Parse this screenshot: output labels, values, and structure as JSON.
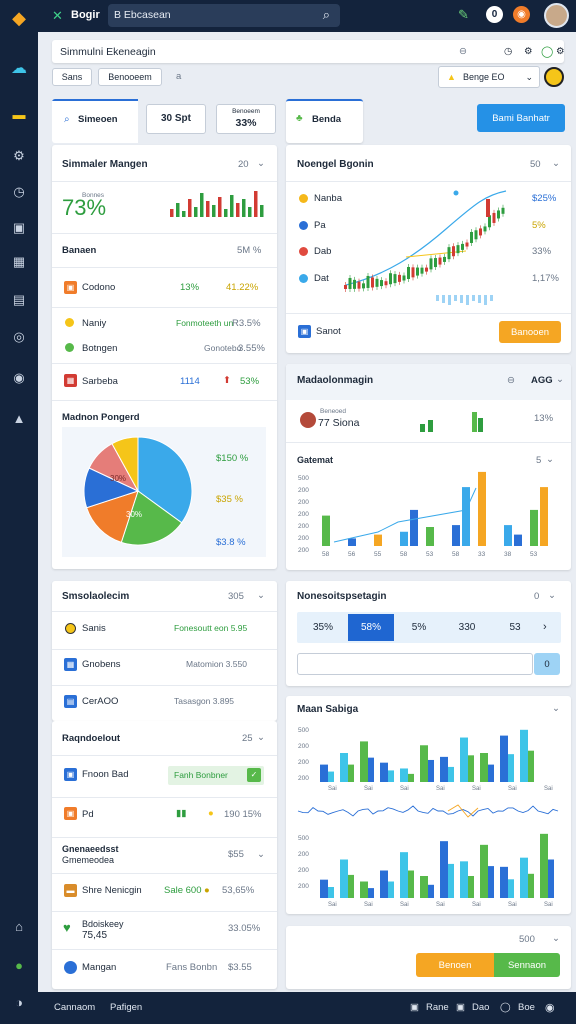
{
  "app": {
    "title": "Bogir",
    "search_text": "B Ebcasean"
  },
  "header": {
    "title": "Simmulni Ekeneagin",
    "bar_tabs": [
      "Sans",
      "Benooeem",
      "a"
    ],
    "select_label": "Benge EO"
  },
  "tabs": [
    {
      "label": "Simeoen"
    },
    {
      "label": "30 Spt"
    },
    {
      "label": "Benoeem",
      "value": "33%"
    },
    {
      "label": "Benda"
    }
  ],
  "action_button": "Bami Banhatr",
  "left_top": {
    "title": "Simmaler Mangen",
    "menu": "20",
    "stat": "73%",
    "stat_label": "Bonnes",
    "section": "Banaen",
    "section_menu": "5M %",
    "rows": [
      {
        "label": "Codono",
        "v1": "13%",
        "v2": "41.22%"
      },
      {
        "label": "Naniy",
        "v1": "Fonmoteeth un",
        "v2": "R3.5%"
      },
      {
        "label": "Botngen",
        "v1": "Gonotebo",
        "v2": "3.55%"
      },
      {
        "label": "Sarbeba",
        "v1": "1114",
        "v2": "53%"
      }
    ],
    "pie_title": "Madnon Pongerd",
    "pie_values": [
      {
        "label": "$150 %",
        "value": 35,
        "color": "#3aa9ea"
      },
      {
        "label": "$35 %",
        "value": 20,
        "color": "#57b94a"
      },
      {
        "label": "",
        "value": 15,
        "color": "#f07c2a"
      },
      {
        "label": "$3.8 %",
        "value": 12,
        "color": "#2a6fd6"
      },
      {
        "label": "",
        "value": 10,
        "color": "#e57d79"
      },
      {
        "label": "",
        "value": 8,
        "color": "#f5c519"
      }
    ],
    "pie_inner_labels": [
      "30%",
      "30%"
    ]
  },
  "right_top": {
    "title": "Noengel Bgonin",
    "menu": "50",
    "legend": [
      {
        "label": "Nanba",
        "value": "$25%",
        "color": "#f5b81a"
      },
      {
        "label": "Pa",
        "value": "5%",
        "color": "#2a6fd6"
      },
      {
        "label": "Dab",
        "value": "33%",
        "color": "#e04a3f"
      },
      {
        "label": "Dat",
        "value": "1,17%",
        "color": "#3aa9ea"
      }
    ],
    "footer_label": "Sanot",
    "footer_button": "Banooen"
  },
  "right_mid": {
    "title": "Madaolonmagin",
    "menu": "AGG",
    "stat_label": "Beneoed",
    "stat": "77 Siona",
    "stat_right": "13%",
    "sub_title": "Gatemat",
    "sub_menu": "5",
    "bars": [
      {
        "x": "58",
        "a": 32,
        "b": 0,
        "c": 0
      },
      {
        "x": "56",
        "a": 8,
        "b": 0,
        "c": 0
      },
      {
        "x": "55",
        "a": 12,
        "b": 0,
        "c": 0
      },
      {
        "x": "58",
        "a": 15,
        "b": 38,
        "c": 0
      },
      {
        "x": "53",
        "a": 20,
        "b": 0,
        "c": 0
      },
      {
        "x": "58",
        "a": 22,
        "b": 62,
        "c": 0
      },
      {
        "x": "33",
        "a": 78,
        "b": 0,
        "c": 0
      },
      {
        "x": "38",
        "a": 22,
        "b": 12,
        "c": 0
      },
      {
        "x": "53",
        "a": 38,
        "b": 62,
        "c": 0
      }
    ],
    "yticks": [
      "500",
      "200",
      "200",
      "200",
      "200",
      "200",
      "200"
    ]
  },
  "right_pager": {
    "title": "Nonesoitspsetagin",
    "menu": "0",
    "pages": [
      "35%",
      "58%",
      "5%",
      "330",
      "53"
    ],
    "active": 1,
    "input_placeholder": "",
    "input_button": "0"
  },
  "right_bottom": {
    "title": "Maan Sabiga",
    "bars1": [
      18,
      30,
      42,
      20,
      14,
      38,
      26,
      46,
      30,
      48,
      54
    ],
    "bars2": [
      20,
      42,
      18,
      30,
      50,
      24,
      62,
      40,
      58,
      34,
      44,
      70
    ],
    "xticks": [
      "Sai",
      "Sai",
      "Sai",
      "Sai",
      "Sai",
      "Sai",
      "Sai"
    ]
  },
  "left_mid": {
    "title": "Smsolaolecim",
    "menu": "305",
    "rows": [
      {
        "label": "Sanis",
        "value": "Fonesoutt eon 5.95"
      },
      {
        "label": "Gnobens",
        "value": "Matomion 3.550"
      },
      {
        "label": "CerAOO",
        "value": "Tasasgon 3.895"
      }
    ]
  },
  "left_bottom": {
    "section": "Raqndoelout",
    "section_menu": "25",
    "rows": [
      {
        "label": "Fnoon Bad",
        "value": "Fanh Bonbner"
      },
      {
        "label": "Pd",
        "value": "190 15%"
      }
    ],
    "section2": "Gnenaeedsst",
    "section2_sub": "Gmemeodea",
    "section2_menu": "$55",
    "rows2": [
      {
        "label": "Shre Nenicgin",
        "value": "Sale 600",
        "v2": "53,65%"
      },
      {
        "label": "Bdoiskeey",
        "value": "75,45",
        "v2": "33.05%"
      },
      {
        "label": "Mangan",
        "value": "Fans Bonbn",
        "v2": "$3.55"
      }
    ]
  },
  "right_foot": {
    "menu": "500",
    "btn1": "Benoen",
    "btn2": "Sennaon"
  },
  "footer": {
    "left1": "Cannaom",
    "left2": "Pafigen",
    "right": [
      "Rane",
      "Dao",
      "Boe"
    ]
  }
}
